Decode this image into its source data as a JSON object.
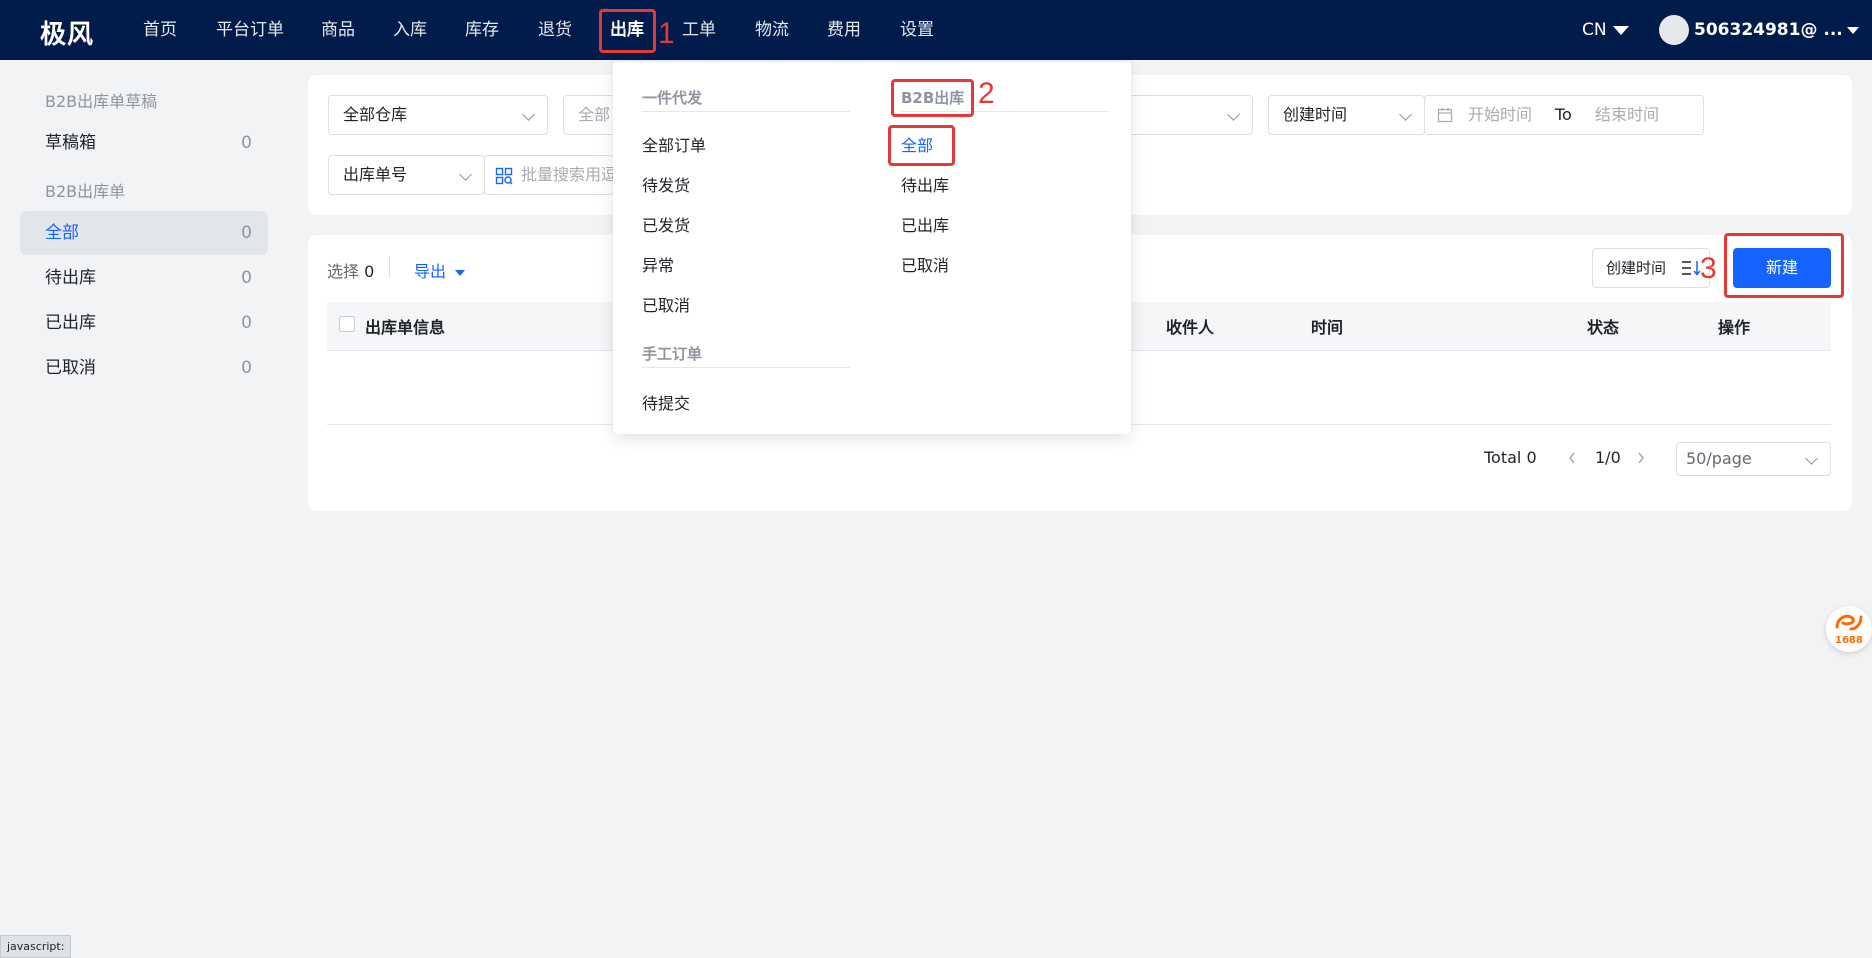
{
  "header": {
    "logo": "极风",
    "nav": [
      "首页",
      "平台订单",
      "商品",
      "入库",
      "库存",
      "退货",
      "出库",
      "工单",
      "物流",
      "费用",
      "设置"
    ],
    "active_nav": "出库",
    "lang": "CN",
    "user": "506324981@ ..."
  },
  "annotations": {
    "n1": "1",
    "n2": "2",
    "n3": "3",
    "color": "#e53935"
  },
  "sidebar": {
    "group1": "B2B出库单草稿",
    "draft": {
      "label": "草稿箱",
      "count": "0"
    },
    "group2": "B2B出库单",
    "items": [
      {
        "label": "全部",
        "count": "0"
      },
      {
        "label": "待出库",
        "count": "0"
      },
      {
        "label": "已出库",
        "count": "0"
      },
      {
        "label": "已取消",
        "count": "0"
      }
    ]
  },
  "filters": {
    "warehouse": "全部仓库",
    "second": "全部",
    "time_type": "创建时间",
    "start": "开始时间",
    "to": "To",
    "end": "结束时间",
    "order_field": "出库单号",
    "batch_search": "批量搜索用逗"
  },
  "toolbar": {
    "select_label": "选择",
    "select_count": "0",
    "export": "导出",
    "sort": "创建时间",
    "new_button": "新建"
  },
  "table": {
    "headers": [
      "出库单信息",
      "收件人",
      "时间",
      "状态",
      "操作"
    ]
  },
  "pagination": {
    "total": "Total 0",
    "page": "1/0",
    "page_size": "50/page"
  },
  "dropdown": {
    "group_a": "一件代发",
    "items_a": [
      "全部订单",
      "待发货",
      "已发货",
      "异常",
      "已取消"
    ],
    "group_b": "手工订单",
    "items_b": [
      "待提交"
    ],
    "group_c": "B2B出库",
    "items_c": [
      "全部",
      "待出库",
      "已出库",
      "已取消"
    ]
  },
  "statusbar": "javascript:",
  "badge": "1688",
  "colors": {
    "nav_bg": "#011c4a",
    "primary": "#1664ff",
    "page_bg": "#f2f3f5"
  }
}
